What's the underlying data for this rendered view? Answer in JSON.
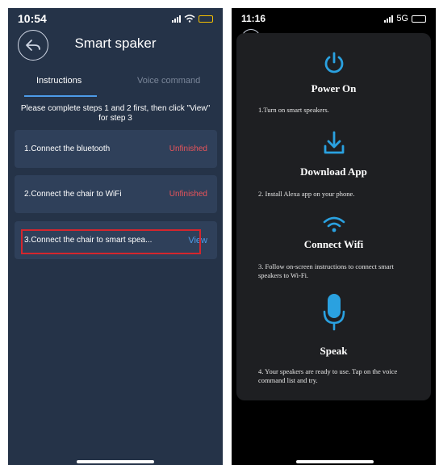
{
  "left": {
    "status": {
      "time": "10:54"
    },
    "title": "Smart spaker",
    "tabs": [
      {
        "label": "Instructions"
      },
      {
        "label": "Voice command"
      }
    ],
    "note": "Please complete steps 1 and 2 first, then click \"View\" for step 3",
    "steps": [
      {
        "label": "1.Connect the bluetooth",
        "status": "Unfinished"
      },
      {
        "label": "2.Connect the chair to WiFi",
        "status": "Unfinished"
      },
      {
        "label": "3.Connect the chair to smart spea...",
        "action": "View"
      }
    ]
  },
  "right": {
    "status": {
      "time": "11:16",
      "network": "5G"
    },
    "sections": [
      {
        "title": "Power On",
        "desc": "1.Turn on smart speakers."
      },
      {
        "title": "Download App",
        "desc": "2. Install Alexa app on your phone."
      },
      {
        "title": "Connect Wifi",
        "desc": "3. Follow on-screen instructions to connect smart speakers to Wi-Fi."
      },
      {
        "title": "Speak",
        "desc": "4. Your speakers are ready to use. Tap on the voice command list and try."
      }
    ]
  },
  "colors": {
    "left_bg": "#253348",
    "card_bg": "#2f405a",
    "accent_blue": "#4d9be8",
    "unfinished_red": "#e8545a",
    "highlight_red": "#d4262d",
    "right_panel_bg": "#1e1f22"
  },
  "icons": [
    "back-arrow-icon",
    "power-icon",
    "download-icon",
    "wifi-icon",
    "microphone-icon"
  ]
}
